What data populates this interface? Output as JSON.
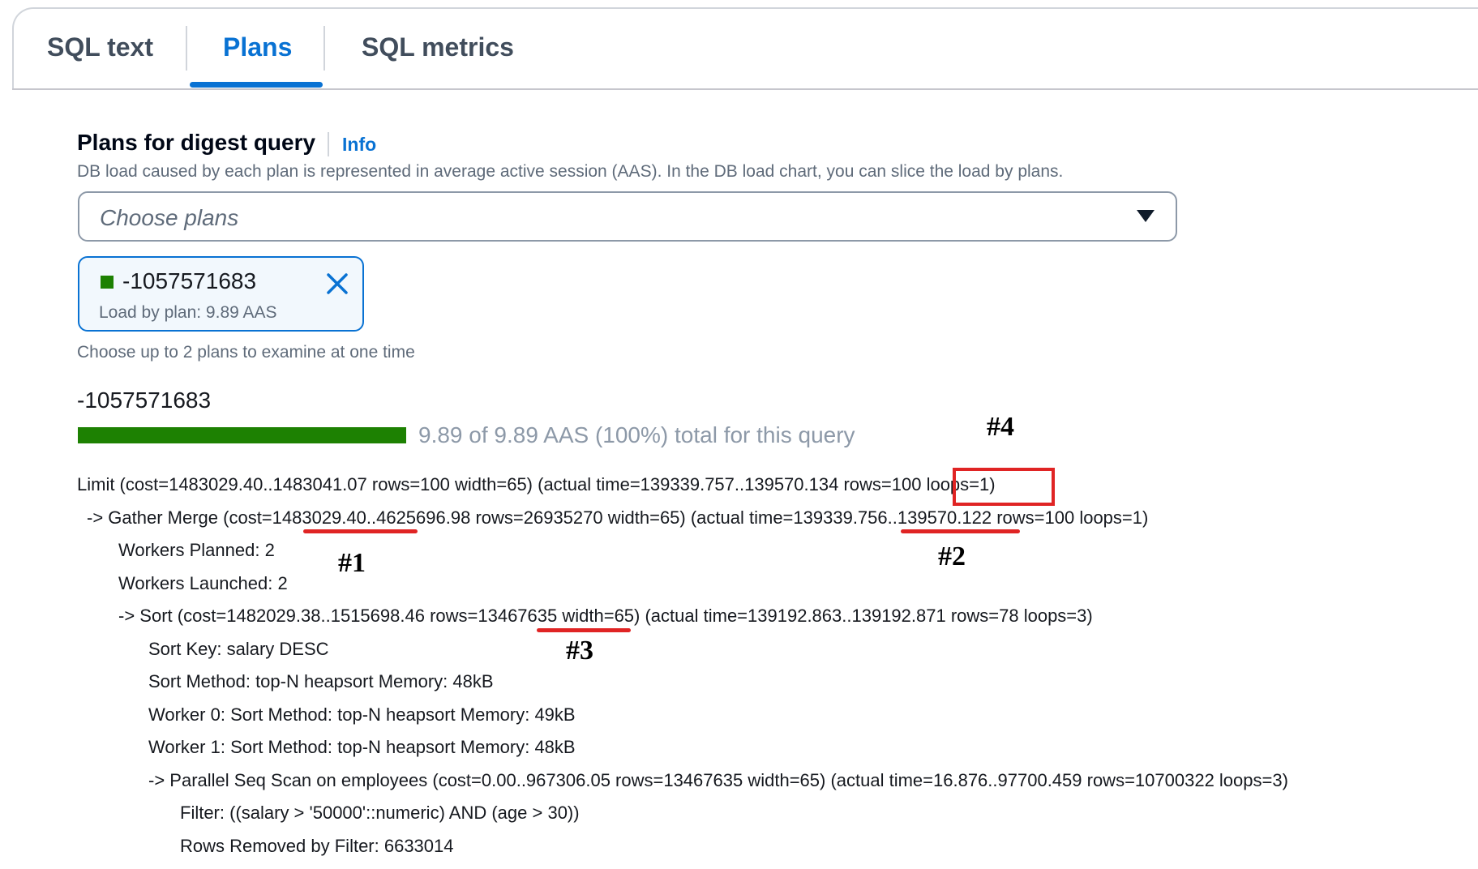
{
  "tabs": [
    {
      "label": "SQL text",
      "active": false
    },
    {
      "label": "Plans",
      "active": true
    },
    {
      "label": "SQL metrics",
      "active": false
    }
  ],
  "section": {
    "title": "Plans for digest query",
    "info_label": "Info",
    "description": "DB load caused by each plan is represented in average active session (AAS). In the DB load chart, you can slice the load by plans."
  },
  "plan_select": {
    "placeholder": "Choose plans",
    "icon": "caret-down-icon"
  },
  "selected_token": {
    "label": "-1057571683",
    "description": "Load by plan: 9.89 AAS",
    "swatch_color": "#1d8102",
    "dismiss_icon": "close-icon"
  },
  "constraint_hint": "Choose up to 2 plans to examine at one time",
  "plan_summary": {
    "plan_id": "-1057571683",
    "load_fraction": 1.0,
    "load_text": "9.89 of 9.89 AAS (100%) total for this query"
  },
  "plan_lines": [
    "Limit  (cost=1483029.40..1483041.07 rows=100 width=65) (actual time=139339.757..139570.134 rows=100 loops=1)",
    "->  Gather Merge  (cost=1483029.40..4625696.98 rows=26935270 width=65) (actual time=139339.756..139570.122 rows=100 loops=1)",
    "Workers Planned: 2",
    "Workers Launched: 2",
    "->  Sort  (cost=1482029.38..1515698.46 rows=13467635 width=65) (actual time=139192.863..139192.871 rows=78 loops=3)",
    "Sort Key: salary DESC",
    "Sort Method: top-N heapsort  Memory: 48kB",
    "Worker 0:  Sort Method: top-N heapsort  Memory: 49kB",
    "Worker 1:  Sort Method: top-N heapsort  Memory: 48kB",
    "->  Parallel Seq Scan on employees  (cost=0.00..967306.05 rows=13467635 width=65) (actual time=16.876..97700.459 rows=10700322 loops=3)",
    "Filter: ((salary > '50000'::numeric) AND (age > 30))",
    "Rows Removed by Filter: 6633014"
  ],
  "annotations": [
    "#1",
    "#2",
    "#3",
    "#4"
  ],
  "annotation_color": "#e02424"
}
